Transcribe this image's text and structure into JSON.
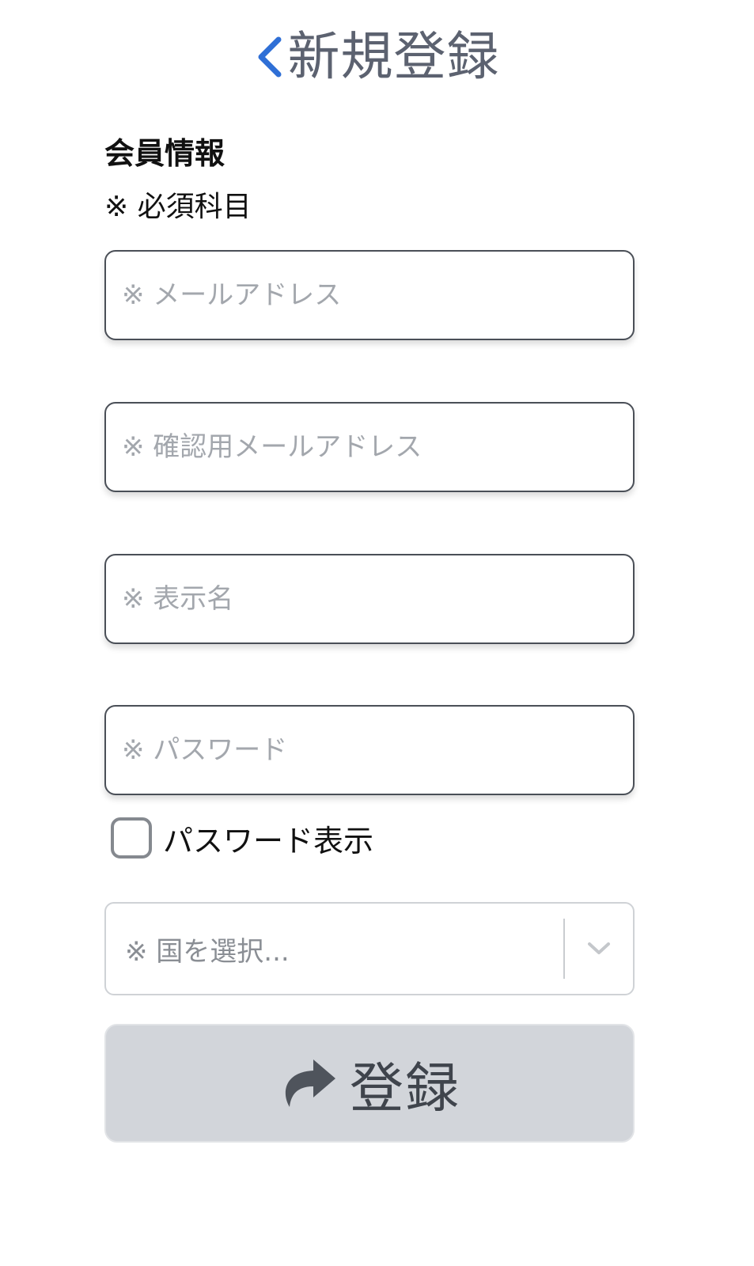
{
  "header": {
    "title": "新規登録",
    "back_icon": "chevron-left-icon",
    "back_color": "#2f6fd6"
  },
  "section": {
    "title": "会員情報",
    "required_note": "※ 必須科目"
  },
  "form": {
    "email_placeholder": "※ メールアドレス",
    "email_confirm_placeholder": "※ 確認用メールアドレス",
    "display_name_placeholder": "※ 表示名",
    "password_placeholder": "※ パスワード",
    "show_password_label": "パスワード表示",
    "show_password_checked": false,
    "country_select_value": "※ 国を選択...",
    "country_select_icon": "chevron-down-icon",
    "submit_label": "登録",
    "submit_icon": "share-arrow-icon"
  }
}
